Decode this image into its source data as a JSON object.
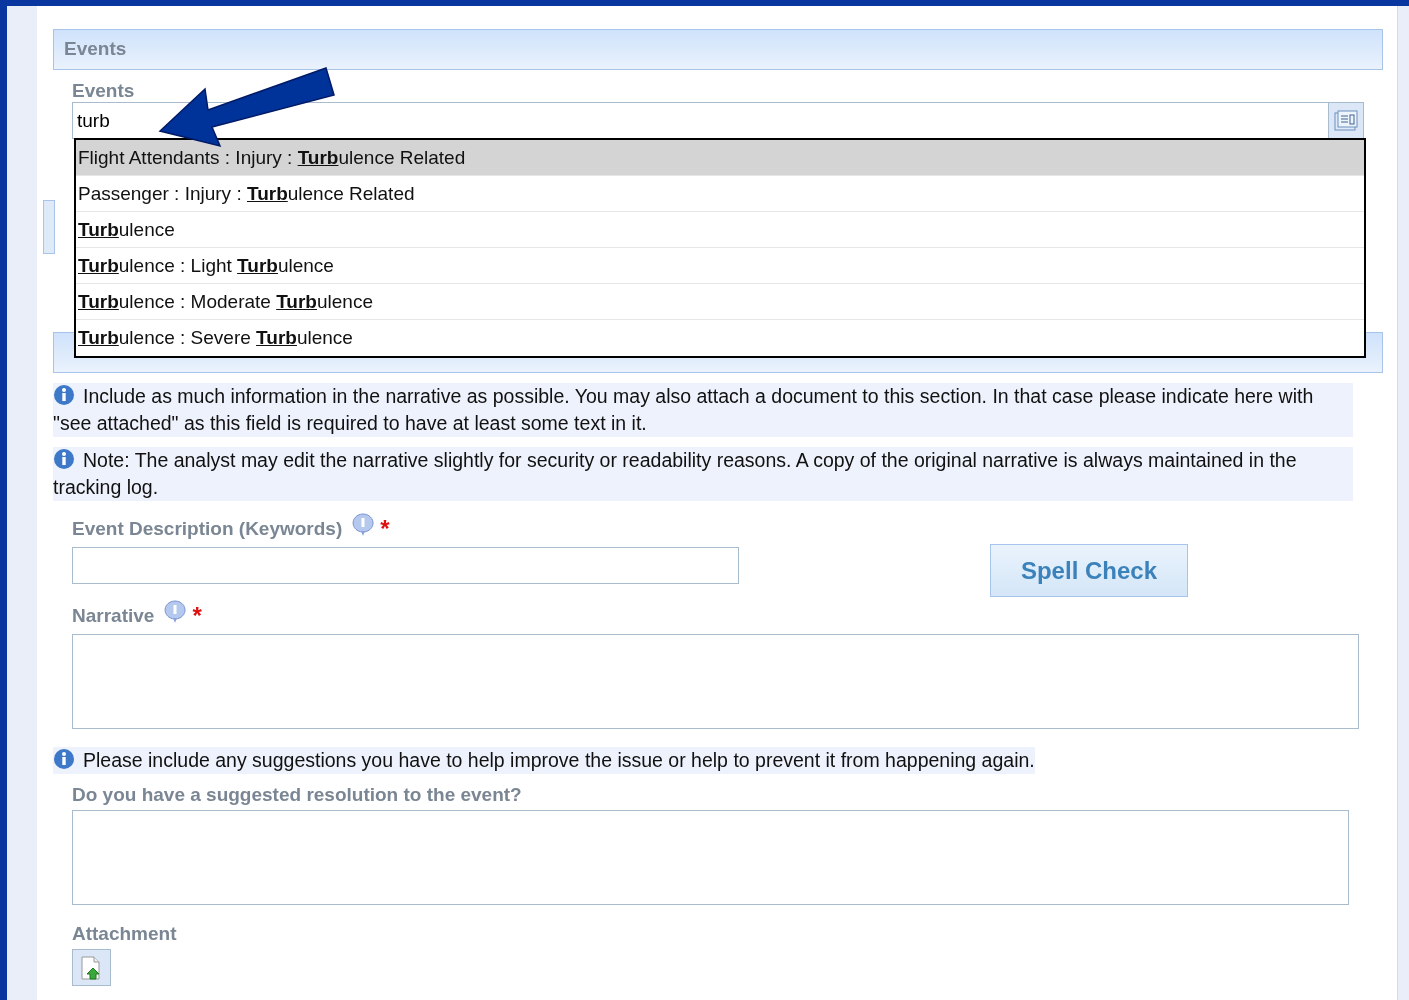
{
  "events_section": {
    "title": "Events"
  },
  "events_field": {
    "label": "Events",
    "value": "turb"
  },
  "suggestions": [
    {
      "text": "Flight Attendants : Injury : **Turb**ulence Related",
      "selected": true
    },
    {
      "text": "Passenger : Injury : **Turb**ulence Related",
      "selected": false
    },
    {
      "text": "**Turb**ulence",
      "selected": false
    },
    {
      "text": "**Turb**ulence : Light **Turb**ulence",
      "selected": false
    },
    {
      "text": "**Turb**ulence : Moderate **Turb**ulence",
      "selected": false
    },
    {
      "text": "**Turb**ulence : Severe **Turb**ulence",
      "selected": false
    }
  ],
  "notes": [
    "Include as much information in the narrative as possible. You may also attach a document to this section. In that case please indicate here with \"see attached\" as this field is required to have at least some text in it.",
    "Note: The analyst may edit the narrative slightly for security or readability reasons. A copy of the original narrative is always maintained in the tracking log."
  ],
  "description_field": {
    "label": "Event Description (Keywords)",
    "required_mark": "*"
  },
  "spell_check_button": "Spell Check",
  "narrative_field": {
    "label": "Narrative",
    "required_mark": "*"
  },
  "suggestion_note": "Please include any suggestions you have to help improve the issue or help to prevent it from happening again.",
  "resolution_field": {
    "label": "Do you have a suggested resolution to the event?"
  },
  "attachment": {
    "label": "Attachment"
  }
}
